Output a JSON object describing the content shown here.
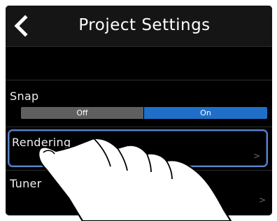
{
  "header": {
    "title": "Project Settings",
    "back_icon": "chevron-left-icon"
  },
  "settings": {
    "snap": {
      "label": "Snap",
      "options": [
        "Off",
        "On"
      ],
      "selected": "On"
    },
    "rendering": {
      "label": "Rendering",
      "chevron": ">",
      "selected": true
    },
    "tuner": {
      "label": "Tuner",
      "chevron": ">"
    }
  },
  "colors": {
    "screen_bg": "#000000",
    "toggle_on": "#1f6fc8",
    "toggle_off": "#5f5f5f",
    "selection_border": "#5b84c8"
  }
}
